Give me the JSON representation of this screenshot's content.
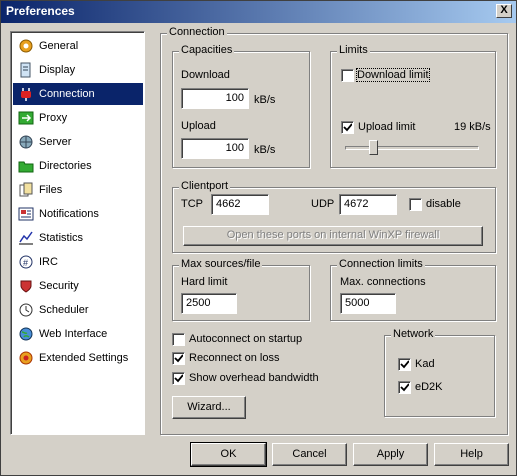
{
  "window": {
    "title": "Preferences",
    "close_label": "X"
  },
  "sidebar": {
    "items": [
      {
        "label": "General",
        "icon": "gear-icon"
      },
      {
        "label": "Display",
        "icon": "display-icon"
      },
      {
        "label": "Connection",
        "icon": "plug-icon",
        "selected": true
      },
      {
        "label": "Proxy",
        "icon": "proxy-icon"
      },
      {
        "label": "Server",
        "icon": "server-icon"
      },
      {
        "label": "Directories",
        "icon": "folder-icon"
      },
      {
        "label": "Files",
        "icon": "files-icon"
      },
      {
        "label": "Notifications",
        "icon": "notification-icon"
      },
      {
        "label": "Statistics",
        "icon": "statistics-icon"
      },
      {
        "label": "IRC",
        "icon": "irc-icon"
      },
      {
        "label": "Security",
        "icon": "security-icon"
      },
      {
        "label": "Scheduler",
        "icon": "clock-icon"
      },
      {
        "label": "Web Interface",
        "icon": "globe-icon"
      },
      {
        "label": "Extended Settings",
        "icon": "extended-settings-icon"
      }
    ]
  },
  "connection": {
    "title": "Connection",
    "capacities": {
      "title": "Capacities",
      "download_label": "Download",
      "download_value": "100",
      "upload_label": "Upload",
      "upload_value": "100",
      "unit": "kB/s"
    },
    "limits": {
      "title": "Limits",
      "download_limit_label": "Download limit",
      "download_limit_checked": false,
      "upload_limit_label": "Upload limit",
      "upload_limit_checked": true,
      "upload_limit_value": "19 kB/s",
      "upload_slider_fraction": 0.19
    },
    "clientport": {
      "title": "Clientport",
      "tcp_label": "TCP",
      "tcp_value": "4662",
      "udp_label": "UDP",
      "udp_value": "4672",
      "disable_label": "disable",
      "disable_checked": false,
      "firewall_button": "Open these ports on internal WinXP firewall"
    },
    "max_sources": {
      "title": "Max sources/file",
      "hard_limit_label": "Hard limit",
      "hard_limit_value": "2500"
    },
    "connection_limits": {
      "title": "Connection limits",
      "max_connections_label": "Max. connections",
      "max_connections_value": "5000"
    },
    "options": {
      "autoconnect_label": "Autoconnect on startup",
      "autoconnect_checked": false,
      "reconnect_label": "Reconnect on loss",
      "reconnect_checked": true,
      "overhead_label": "Show overhead bandwidth",
      "overhead_checked": true,
      "wizard_button": "Wizard..."
    },
    "network": {
      "title": "Network",
      "kad_label": "Kad",
      "kad_checked": true,
      "ed2k_label": "eD2K",
      "ed2k_checked": true
    }
  },
  "buttons": {
    "ok": "OK",
    "cancel": "Cancel",
    "apply": "Apply",
    "help": "Help"
  }
}
